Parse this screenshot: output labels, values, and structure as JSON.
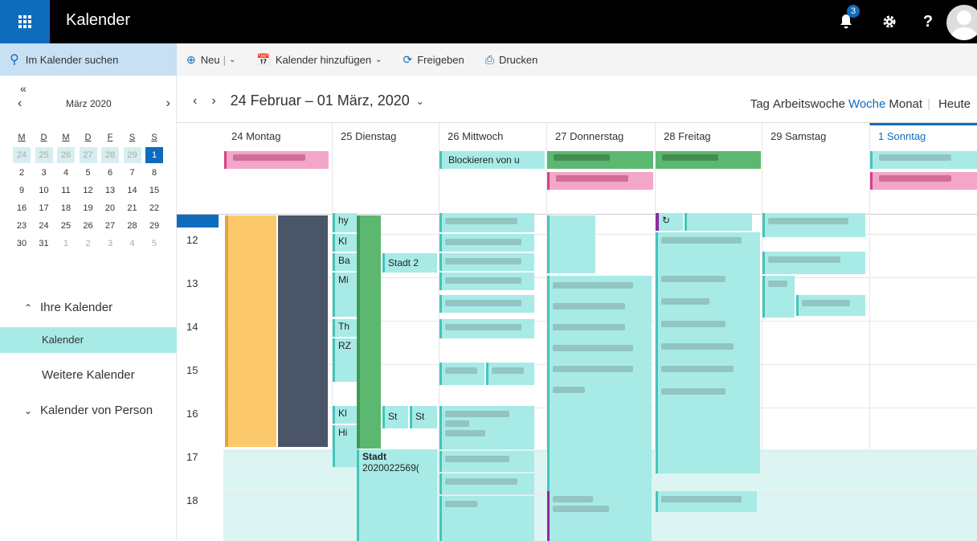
{
  "header": {
    "title": "Kalender",
    "notification_count": "3",
    "settings_icon": "gear-icon",
    "help_label": "?"
  },
  "search": {
    "label": "Im Kalender suchen"
  },
  "toolbar": {
    "new_label": "Neu",
    "add_cal_label": "Kalender hinzufügen",
    "share_label": "Freigeben",
    "print_label": "Drucken"
  },
  "minical": {
    "collapse": "«",
    "month_label": "März 2020",
    "dow": [
      "M",
      "D",
      "M",
      "D",
      "F",
      "S",
      "S"
    ],
    "weeks": [
      [
        "24",
        "25",
        "26",
        "27",
        "28",
        "29",
        "1"
      ],
      [
        "2",
        "3",
        "4",
        "5",
        "6",
        "7",
        "8"
      ],
      [
        "9",
        "10",
        "11",
        "12",
        "13",
        "14",
        "15"
      ],
      [
        "16",
        "17",
        "18",
        "19",
        "20",
        "21",
        "22"
      ],
      [
        "23",
        "24",
        "25",
        "26",
        "27",
        "28",
        "29"
      ],
      [
        "30",
        "31",
        "1",
        "2",
        "3",
        "4",
        "5"
      ]
    ]
  },
  "sidebar": {
    "your_cals": "Ihre Kalender",
    "cal_item": "Kalender",
    "more_cals": "Weitere Kalender",
    "people_cals": "Kalender von Person"
  },
  "main": {
    "range_label": "24 Februar – 01 März, 2020",
    "views": [
      "Tag",
      "Arbeitswoche",
      "Woche",
      "Monat",
      "Heute"
    ],
    "active_view": "Woche",
    "days": [
      "24 Montag",
      "25 Dienstag",
      "26 Mittwoch",
      "27 Donnerstag",
      "28 Freitag",
      "29 Samstag",
      "1 Sonntag"
    ],
    "hours": [
      "12",
      "13",
      "14",
      "15",
      "16",
      "17",
      "18"
    ],
    "allday_blocking": "Blockieren von u",
    "events": {
      "tue_1": "hy",
      "tue_2": "Kl",
      "tue_3": "Ba",
      "tue_4": "Mi",
      "tue_5": "Th",
      "tue_6": "RZ",
      "tue_7": "Kl",
      "tue_8": "Hi",
      "tue_stadt_short": "Stadt 2",
      "tue_st1": "St",
      "tue_st2": "St",
      "stadt_title": "Stadt",
      "stadt_sub": "2020022569("
    }
  },
  "colors": {
    "accent": "#0f6cbd",
    "event": "#a8ebe6",
    "event_border": "#45c4bb",
    "pink": "#f4a6c9",
    "green": "#5cb870",
    "orange": "#fbc96b",
    "slate": "#4a5568"
  }
}
